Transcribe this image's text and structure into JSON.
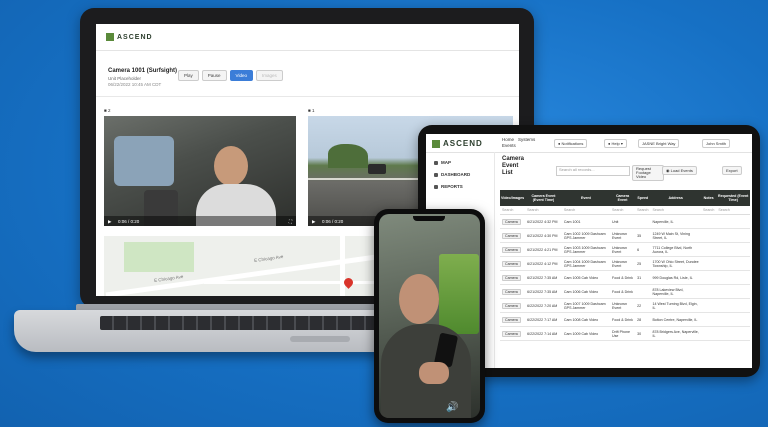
{
  "brand": {
    "logo_text": "ASCEND",
    "accent": "#5a8a3a",
    "primary_blue": "#3b7dd8",
    "background": "#1775c9"
  },
  "laptop": {
    "camera_title": "Camera 1001 (Surfsight)",
    "camera_subtitle": "Unit Placeholder",
    "camera_date": "06/22/2022 10:45 AM CDT",
    "controls": [
      "Play",
      "Pause",
      "Video",
      "Images"
    ],
    "active_control": "Video",
    "video_inside": {
      "label": "2",
      "time": "0:06 / 0:20"
    },
    "video_road": {
      "label": "1",
      "time": "0:06 / 0:20"
    },
    "map_streets": [
      "E Chicago Ave",
      "E Chicago Ave"
    ]
  },
  "tablet": {
    "nav": {
      "home": "Home",
      "events": "Events",
      "systems": "Systems"
    },
    "notifications": "Notifications",
    "help": "Help",
    "user": "John Smith",
    "location": "JASNE Bright Way",
    "sidebar": [
      "MAP",
      "DASHBOARD",
      "REPORTS"
    ],
    "heading": [
      "Camera",
      "Event",
      "List"
    ],
    "search_placeholder": "Search all records...",
    "buttons": {
      "request": "Request Footage Video",
      "load": "Load Events",
      "export": "Export"
    },
    "columns": [
      "Video/Images",
      "Camera Event (Event Time)",
      "Event",
      "Camera Event",
      "Speed",
      "Address",
      "Notes",
      "Requested (Event Time)"
    ],
    "search_row": [
      "Search",
      "Search",
      "Search",
      "Search",
      "Search",
      "Search",
      "Search",
      "Search"
    ],
    "rows": [
      {
        "video": "Camera",
        "time": "6/21/2022 4:32 PM",
        "cam": "Cam 1001",
        "event": "Unit",
        "speed": "",
        "address": "Naperville, IL"
      },
      {
        "video": "Camera",
        "time": "6/21/2022 4:30 PM",
        "cam": "Cam 1002 1009 Dashcam GPS Jammer",
        "event": "Unknown Event",
        "speed": "35",
        "address": "1249 W Main St, Vining Street, IL"
      },
      {
        "video": "Camera",
        "time": "6/21/2022 4:21 PM",
        "cam": "Cam 1003 1009 Dashcam GPS Jammer",
        "event": "Unknown Event",
        "speed": "6",
        "address": "7711 College Blvd, North Aurora, IL"
      },
      {
        "video": "Camera",
        "time": "6/21/2022 4:12 PM",
        "cam": "Cam 1004 1009 Dashcam GPS Jammer",
        "event": "Unknown Event",
        "speed": "25",
        "address": "1700 W Ohio Street, Dundee Township, IL"
      },
      {
        "video": "Camera",
        "time": "6/21/2022 7:35 AM",
        "cam": "Cam 1005 Cab Video",
        "event": "Food & Drink",
        "speed": "31",
        "address": "999 Douglas Rd, Lisle, IL"
      },
      {
        "video": "Camera",
        "time": "6/21/2022 7:35 AM",
        "cam": "Cam 1006 Cab Video",
        "event": "Food & Drink",
        "speed": "",
        "address": "878 Lakeview Blvd, Naperville, IL"
      },
      {
        "video": "Camera",
        "time": "6/22/2022 7:20 AM",
        "cam": "Cam 1007 1009 Dashcam GPS Jammer",
        "event": "Unknown Event",
        "speed": "22",
        "address": "14 West Turning Blvd, Elgin, IL"
      },
      {
        "video": "Camera",
        "time": "6/22/2022 7:17 AM",
        "cam": "Cam 1008 Cab Video",
        "event": "Food & Drink",
        "speed": "28",
        "address": "Bolton Centre, Naperville, IL"
      },
      {
        "video": "Camera",
        "time": "6/22/2022 7:14 AM",
        "cam": "Cam 1009 Cab Video",
        "event": "Drift Phone Use",
        "speed": "30",
        "address": "878 Bridgers Ave, Naperville, IL"
      }
    ]
  },
  "phone": {
    "speaker_icon": "speaker-icon"
  }
}
